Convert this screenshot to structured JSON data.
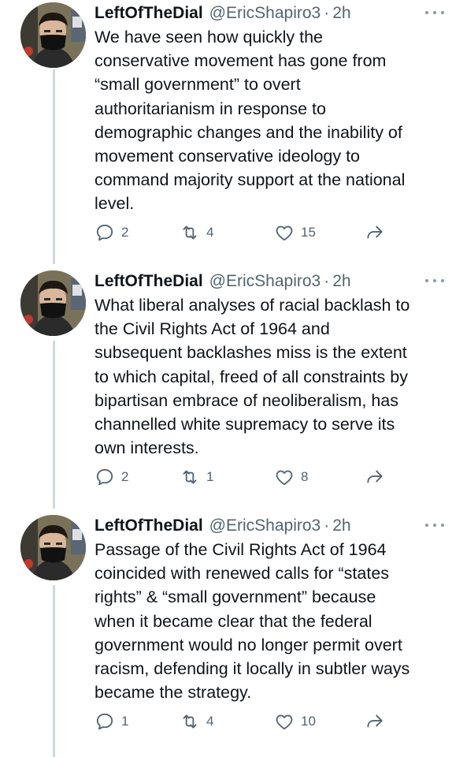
{
  "tweets": [
    {
      "author_name": "LeftOfTheDial",
      "handle": "@EricShapiro3",
      "separator": "·",
      "time": "2h",
      "text": "We have seen how quickly the\nconservative movement has gone from\n“small government” to overt\nauthoritarianism in response to\ndemographic changes and the inability of\nmovement conservative ideology to\ncommand majority support at the national\nlevel.",
      "replies": "2",
      "retweets": "4",
      "likes": "15"
    },
    {
      "author_name": "LeftOfTheDial",
      "handle": "@EricShapiro3",
      "separator": "·",
      "time": "2h",
      "text": "What liberal analyses of racial backlash to\nthe Civil Rights Act of 1964 and\nsubsequent backlashes miss is the extent\nto which capital, freed of all constraints by\nbipartisan embrace of neoliberalism, has\nchannelled white supremacy to serve its\nown interests.",
      "replies": "2",
      "retweets": "1",
      "likes": "8"
    },
    {
      "author_name": "LeftOfTheDial",
      "handle": "@EricShapiro3",
      "separator": "·",
      "time": "2h",
      "text": "Passage of the Civil Rights Act of 1964\ncoincided with renewed calls for “states\nrights” & “small government” because\nwhen it became clear that the federal\ngovernment would no longer permit overt\nracism, defending it locally in subtler ways\nbecame the strategy.",
      "replies": "1",
      "retweets": "4",
      "likes": "10"
    }
  ],
  "icons": {
    "reply": "reply-icon",
    "retweet": "retweet-icon",
    "like": "heart-icon",
    "share": "share-icon",
    "more": "more-options-icon",
    "avatar": "avatar"
  },
  "colors": {
    "text": "#0f1419",
    "secondary": "#536471",
    "thread_line": "#cfd9de",
    "background": "#ffffff"
  }
}
